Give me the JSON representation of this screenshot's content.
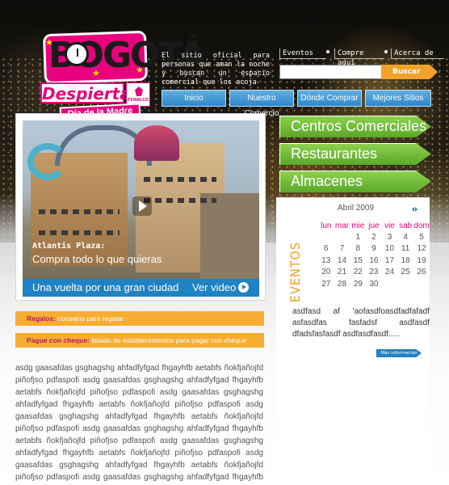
{
  "logo": {
    "word": "BOGOTÁ",
    "banner": "Despierta",
    "badge": "FENALCO",
    "subtitle": "Día de la Madre"
  },
  "tagline": "El sitio oficial para personas que aman la noche y buscan un espacio comercial que los acoja",
  "top_links": [
    "Eventos",
    "Compre aquí",
    "Acerca de"
  ],
  "search": {
    "placeholder": "",
    "button": "Buscar"
  },
  "nav": [
    "Inicio",
    "Nuestro Comercio",
    "Dónde Comprar",
    "Mejores Sitios"
  ],
  "video": {
    "place": "Atlantis Plaza:",
    "headline": "Compra todo lo que quieras",
    "bar_text": "Una vuelta por una gran ciudad",
    "bar_link": "Ver video"
  },
  "categories": [
    "Centros Comerciales",
    "Restaurantes",
    "Almacenes"
  ],
  "calendar": {
    "label": "EVENTOS",
    "month": "Abril 2009",
    "weekdays": [
      "lun",
      "mar",
      "mie",
      "jue",
      "vie",
      "sab",
      "dom"
    ],
    "weeks": [
      [
        "",
        "",
        "1",
        "2",
        "3",
        "4",
        "5"
      ],
      [
        "6",
        "7",
        "8",
        "9",
        "10",
        "11",
        "12"
      ],
      [
        "13",
        "14",
        "15",
        "16",
        "17",
        "18",
        "19"
      ],
      [
        "20",
        "21",
        "22",
        "23",
        "24",
        "25",
        "26"
      ],
      [
        "27",
        "28",
        "29",
        "30",
        "",
        "",
        ""
      ]
    ],
    "text": "asdfasd af 'aofasdfoasdfadfafadf asfasdfas fasfadsf asdfasdf dfadsfasfasdf asdfasdfasdf.....",
    "more": "Más información"
  },
  "info_bars": [
    {
      "label": "Regalos:",
      "text": "consejos para regalar"
    },
    {
      "label": "Pague con cheque:",
      "text": "listado de establecimientos para pagar con cheque"
    }
  ],
  "body_text": "asdg gaasafdas gsghagshg ahfadfyfgad fhgayhfb aetabfs ñokfjañojfd piñofjso pdfaspofi asdg gaasafdas gsghagshg ahfadfyfgad fhgayhfb aetabfs ñokfjañojfd piñofjso pdfaspofi asdg gaasafdas gsghagshg ahfadfyfgad fhgayhfb aetabfs ñokfjañojfd piñofjso pdfaspofi asdg gaasafdas gsghagshg ahfadfyfgad fhgayhfb aetabfs ñokfjañojfd piñofjso pdfaspofi asdg gaasafdas gsghagshg ahfadfyfgad fhgayhfb aetabfs ñokfjañojfd piñofjso pdfaspofi asdg gaasafdas gsghagshg ahfadfyfgad fhgayhfb aetabfs ñokfjañojfd piñofjso pdfaspofi asdg gaasafdas gsghagshg ahfadfyfgad fhgayhfb aetabfs ñokfjañojfd piñofjso pdfaspofi asdg gaasafdas gsghagshg ahfadfyfgad fhgayhfb aetabfs ñokfjañojfd piñofjso pdfaspofi",
  "colors": {
    "pink": "#e8007c",
    "green": "#6cbc35",
    "blue": "#1f82c2",
    "orange": "#f6ad31"
  }
}
